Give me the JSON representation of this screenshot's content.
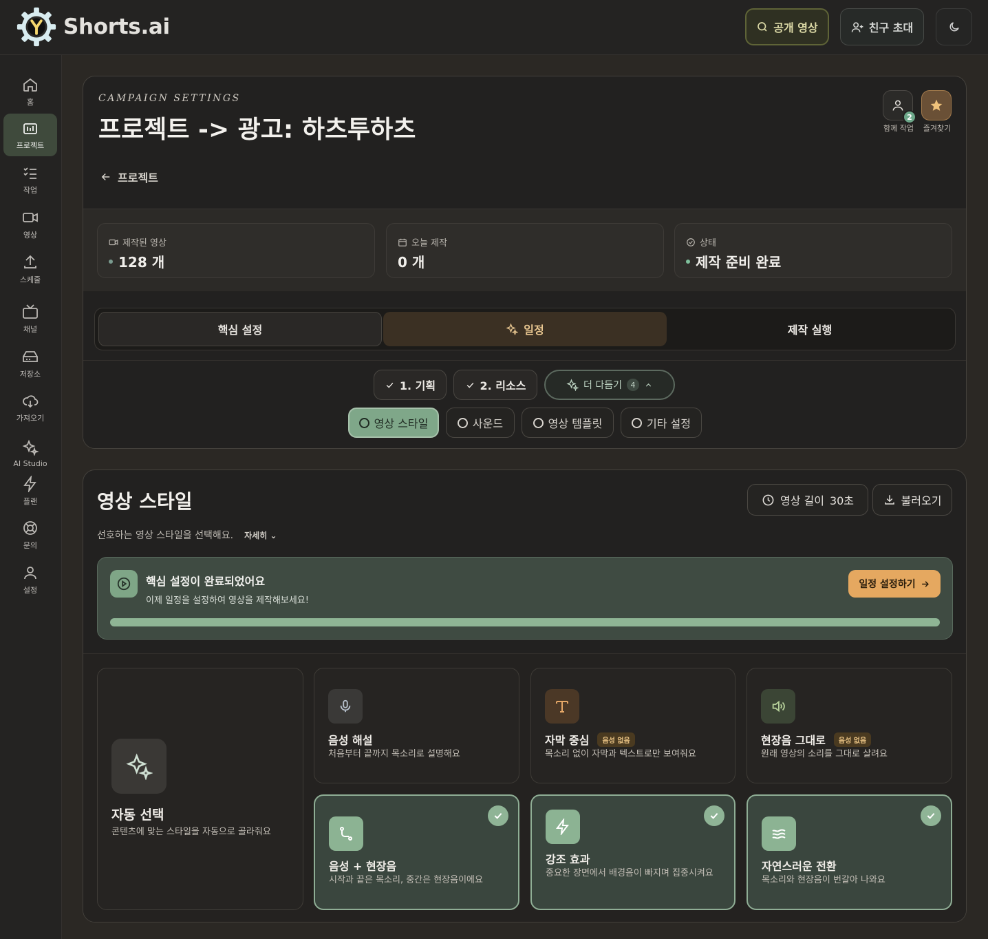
{
  "brand": {
    "name": "Shorts.ai"
  },
  "topbar": {
    "public_video": "공개 영상",
    "invite": "친구 초대"
  },
  "sidebar": {
    "items": [
      {
        "label": "홈",
        "icon": "home-icon"
      },
      {
        "label": "프로젝트",
        "icon": "project-icon",
        "active": true
      },
      {
        "label": "작업",
        "icon": "task-list-icon"
      },
      {
        "label": "영상",
        "icon": "video-icon"
      },
      {
        "label": "스케줄",
        "icon": "upload-icon"
      },
      {
        "label": "채널",
        "icon": "tv-icon"
      },
      {
        "label": "저장소",
        "icon": "storage-icon"
      },
      {
        "label": "가져오기",
        "icon": "cloud-download-icon"
      },
      {
        "label": "AI Studio",
        "icon": "sparkles-icon"
      },
      {
        "label": "플랜",
        "icon": "lightning-icon"
      },
      {
        "label": "문의",
        "icon": "lifebuoy-icon"
      },
      {
        "label": "설정",
        "icon": "user-icon"
      }
    ]
  },
  "header": {
    "eyebrow": "CAMPAIGN SETTINGS",
    "title": "프로젝트 -> 광고: 하츠투하츠",
    "collab_label": "함께 작업",
    "collab_count": "2",
    "favorite_label": "즐겨찾기",
    "back_label": "프로젝트"
  },
  "stats": [
    {
      "label": "제작된 영상",
      "value": "128 개",
      "icon": "video-icon"
    },
    {
      "label": "오늘 제작",
      "value": "0 개",
      "icon": "calendar-icon"
    },
    {
      "label": "상태",
      "value": "제작 준비 완료",
      "icon": "check-circle-icon"
    }
  ],
  "tabs": [
    "핵심 설정",
    "일정",
    "제작 실행"
  ],
  "steps": {
    "done": [
      "1. 기획",
      "2. 리소스"
    ],
    "more_label": "더 다듬기",
    "more_count": "4",
    "chips": [
      "영상 스타일",
      "사운드",
      "영상 템플릿",
      "기타 설정"
    ],
    "active_chip": "영상 스타일"
  },
  "section": {
    "title": "영상 스타일",
    "subtitle": "선호하는 영상 스타일을 선택해요.",
    "more": "자세히",
    "length_label": "영상 길이",
    "length_value": "30초",
    "load_label": "불러오기"
  },
  "banner": {
    "title": "핵심 설정이 완료되었어요",
    "text": "이제 일정을 설정하여 영상을 제작해보세요!",
    "button": "일정 설정하기",
    "progress": 1.0
  },
  "cards": {
    "auto": {
      "title": "자동 선택",
      "desc": "콘텐츠에 맞는 스타일을 자동으로 골라줘요"
    },
    "narration": {
      "title": "음성 해설",
      "desc": "처음부터 끝까지 목소리로 설명해요"
    },
    "subtitle": {
      "title": "자막 중심",
      "tag": "음성 없음",
      "desc": "목소리 없이 자막과 텍스트로만 보여줘요"
    },
    "ambient": {
      "title": "현장음 그대로",
      "tag": "음성 없음",
      "desc": "원래 영상의 소리를 그대로 살려요"
    },
    "mixed": {
      "title": "음성 + 현장음",
      "desc": "시작과 끝은 목소리, 중간은 현장음이에요"
    },
    "emphasis": {
      "title": "강조 효과",
      "desc": "중요한 장면에서 배경음이 빠지며 집중시켜요"
    },
    "natural": {
      "title": "자연스러운 전환",
      "desc": "목소리와 현장음이 번갈아 나와요"
    }
  }
}
